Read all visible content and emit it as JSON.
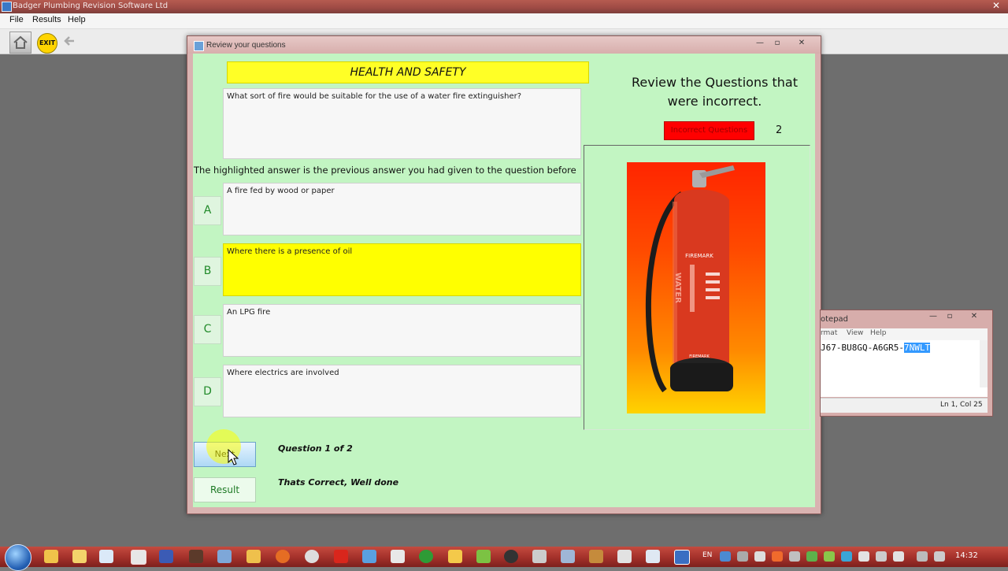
{
  "app": {
    "title": "Badger Plumbing Revision Software Ltd",
    "menu": [
      "File",
      "Results",
      "Help"
    ],
    "toolbar": {
      "exit_label": "EXIT"
    }
  },
  "dialog": {
    "title": "Review your questions",
    "heading": "HEALTH AND SAFETY",
    "question": "What sort of fire would be suitable for the use of a water fire extinguisher?",
    "hint": "The highlighted answer is the previous answer you had given to the question before",
    "answers": [
      {
        "letter": "A",
        "text": "A fire fed by wood or paper",
        "highlighted": false
      },
      {
        "letter": "B",
        "text": "Where there is a presence of oil",
        "highlighted": true
      },
      {
        "letter": "C",
        "text": "An LPG fire",
        "highlighted": false
      },
      {
        "letter": "D",
        "text": "Where electrics are involved",
        "highlighted": false
      }
    ],
    "next_label": "Next",
    "result_label": "Result",
    "question_counter": "Question 1 of 2",
    "feedback": "Thats Correct, Well done",
    "review_title": "Review the Questions that were incorrect.",
    "incorrect_button": "Incorrect Questions",
    "incorrect_count": "2",
    "extinguisher_brand": "FIREMARK",
    "extinguisher_word": "WATER"
  },
  "notepad": {
    "title": "otepad",
    "menu": [
      "rmat",
      "View",
      "Help"
    ],
    "text": "J67-BU8GQ-A6GR5-",
    "selected_text": "7NWLT",
    "status": "Ln 1, Col 25"
  },
  "taskbar": {
    "lang": "EN",
    "time": "14:32"
  },
  "colors": {
    "dialog_background": "#c2f5c2",
    "heading_yellow": "#ffff26",
    "highlight_yellow": "#ffff00",
    "incorrect_red": "#ff0000"
  }
}
